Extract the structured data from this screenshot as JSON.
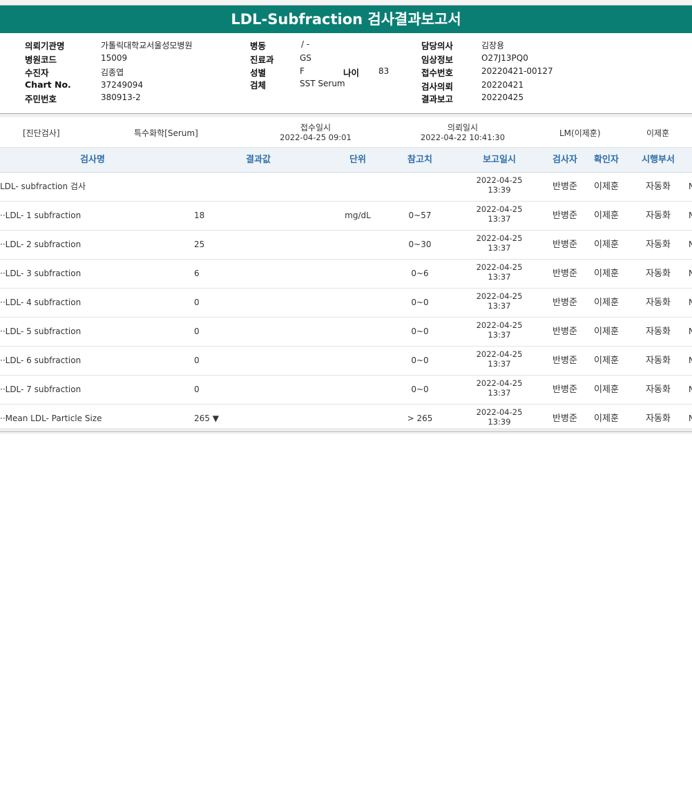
{
  "report": {
    "title": "LDL-Subfraction 검사결과보고서"
  },
  "patient": {
    "institution_label": "의뢰기관명",
    "institution": "가톨릭대학교서울성모병원",
    "hospital_code_label": "병원코드",
    "hospital_code": "15009",
    "patient_label": "수진자",
    "patient_name": "김종엽",
    "chart_label": "Chart No.",
    "chart_no": "37249094",
    "resident_label": "주민번호",
    "resident_no": "380913-2",
    "ward_label": "병동",
    "ward": "/ -",
    "department_label": "진료과",
    "department": "GS",
    "sex_label": "성별",
    "sex": "F",
    "age_label": "나이",
    "age": "83",
    "specimen_label": "검체",
    "specimen": "SST Serum",
    "doctor_label": "담당의사",
    "doctor": "김장용",
    "clinical_label": "임상정보",
    "clinical": "O27J13PQ0",
    "accession_label": "접수번호",
    "accession": "20220421-00127",
    "request_label": "검사의뢰",
    "request_date": "20220421",
    "report_label": "결과보고",
    "report_date": "20220425"
  },
  "summary": {
    "category": "[진단검사]",
    "group": "특수화학[Serum]",
    "received_label": "접수일시",
    "received": "2022-04-25  09:01",
    "requested_label": "의뢰일시",
    "requested": "2022-04-22  10:41:30",
    "lm": "LM(이제훈)",
    "confirmer": "이제훈"
  },
  "columns": {
    "name": "검사명",
    "result": "결과값",
    "unit": "단위",
    "reference": "참고치",
    "report_time": "보고일시",
    "tester": "검사자",
    "confirmer": "확인자",
    "dept": "시행부서"
  },
  "rows": [
    {
      "name": "LDL- subfraction 검사",
      "result": "",
      "unit": "",
      "reference": "",
      "date": "2022-04-25",
      "time": "13:39",
      "tester": "반병준",
      "confirmer": "이제훈",
      "dept": "자동화",
      "extra": "N"
    },
    {
      "name": "··LDL- 1 subfraction",
      "result": "18",
      "unit": "mg/dL",
      "reference": "0~57",
      "date": "2022-04-25",
      "time": "13:37",
      "tester": "반병준",
      "confirmer": "이제훈",
      "dept": "자동화",
      "extra": "N"
    },
    {
      "name": "··LDL- 2 subfraction",
      "result": "25",
      "unit": "",
      "reference": "0~30",
      "date": "2022-04-25",
      "time": "13:37",
      "tester": "반병준",
      "confirmer": "이제훈",
      "dept": "자동화",
      "extra": "N"
    },
    {
      "name": "··LDL- 3 subfraction",
      "result": "6",
      "unit": "",
      "reference": "0~6",
      "date": "2022-04-25",
      "time": "13:37",
      "tester": "반병준",
      "confirmer": "이제훈",
      "dept": "자동화",
      "extra": "N"
    },
    {
      "name": "··LDL- 4 subfraction",
      "result": "0",
      "unit": "",
      "reference": "0~0",
      "date": "2022-04-25",
      "time": "13:37",
      "tester": "반병준",
      "confirmer": "이제훈",
      "dept": "자동화",
      "extra": "N"
    },
    {
      "name": "··LDL- 5 subfraction",
      "result": "0",
      "unit": "",
      "reference": "0~0",
      "date": "2022-04-25",
      "time": "13:37",
      "tester": "반병준",
      "confirmer": "이제훈",
      "dept": "자동화",
      "extra": "N"
    },
    {
      "name": "··LDL- 6 subfraction",
      "result": "0",
      "unit": "",
      "reference": "0~0",
      "date": "2022-04-25",
      "time": "13:37",
      "tester": "반병준",
      "confirmer": "이제훈",
      "dept": "자동화",
      "extra": "N"
    },
    {
      "name": "··LDL- 7 subfraction",
      "result": "0",
      "unit": "",
      "reference": "0~0",
      "date": "2022-04-25",
      "time": "13:37",
      "tester": "반병준",
      "confirmer": "이제훈",
      "dept": "자동화",
      "extra": "N"
    },
    {
      "name": "··Mean LDL- Particle Size",
      "result": "265 ▼",
      "unit": "",
      "reference": "> 265",
      "date": "2022-04-25",
      "time": "13:39",
      "tester": "반병준",
      "confirmer": "이제훈",
      "dept": "자동화",
      "extra": "N"
    }
  ]
}
